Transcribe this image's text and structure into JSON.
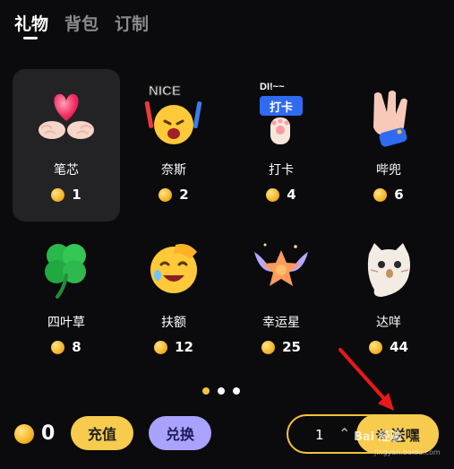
{
  "tabs": [
    {
      "label": "礼物",
      "active": true
    },
    {
      "label": "背包",
      "active": false
    },
    {
      "label": "订制",
      "active": false
    }
  ],
  "gifts": [
    {
      "name": "笔芯",
      "price": "1",
      "icon": "heart-hands-icon",
      "selected": true
    },
    {
      "name": "奈斯",
      "price": "2",
      "icon": "nice-emoji-icon",
      "badge": "NICE",
      "selected": false
    },
    {
      "name": "打卡",
      "price": "4",
      "icon": "clock-in-icon",
      "badge": "DI!~~",
      "sign": "打卡",
      "selected": false
    },
    {
      "name": "哔兜",
      "price": "6",
      "icon": "waving-hand-icon",
      "selected": false
    },
    {
      "name": "四叶草",
      "price": "8",
      "icon": "four-leaf-clover-icon",
      "selected": false
    },
    {
      "name": "扶额",
      "price": "12",
      "icon": "facepalm-emoji-icon",
      "selected": false
    },
    {
      "name": "幸运星",
      "price": "25",
      "icon": "winged-star-icon",
      "selected": false
    },
    {
      "name": "达咩",
      "price": "44",
      "icon": "ghost-cat-icon",
      "selected": false
    }
  ],
  "pagination": {
    "pages": 3,
    "current": 1
  },
  "wallet": {
    "balance": "0"
  },
  "buttons": {
    "recharge": "充值",
    "exchange": "兑换",
    "send": "送嘿"
  },
  "quantity": {
    "value": "1"
  },
  "watermark": {
    "text": "Bai 经验",
    "sub": "jingyan.baidu.com"
  },
  "colors": {
    "accent": "#f5c23a",
    "exchange": "#a9a2ff",
    "background": "#0b0b0d"
  }
}
